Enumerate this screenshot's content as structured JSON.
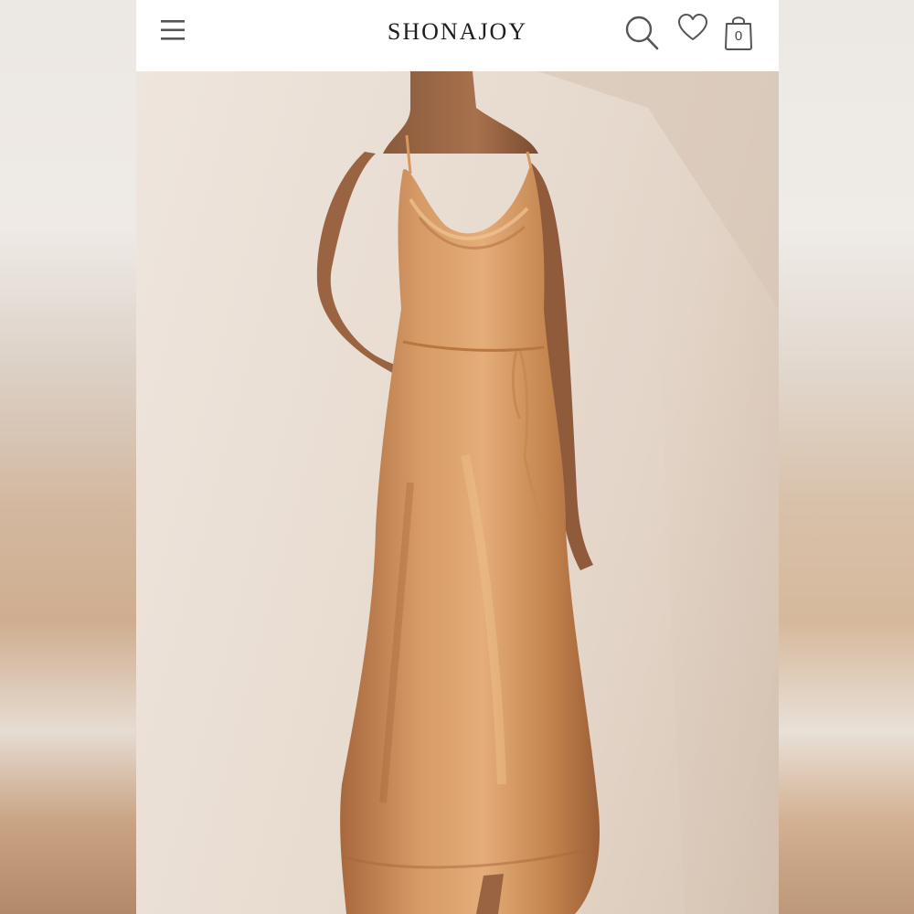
{
  "header": {
    "brand": "SHONAJOY",
    "bag_count": "0"
  },
  "icons": {
    "menu": "hamburger-menu-icon",
    "search": "search-icon",
    "wishlist": "heart-icon",
    "bag": "shopping-bag-icon"
  },
  "colors": {
    "dress": "#c98a57",
    "background": "#e9ddd2",
    "header_bg": "#ffffff",
    "icon": "#555555"
  }
}
